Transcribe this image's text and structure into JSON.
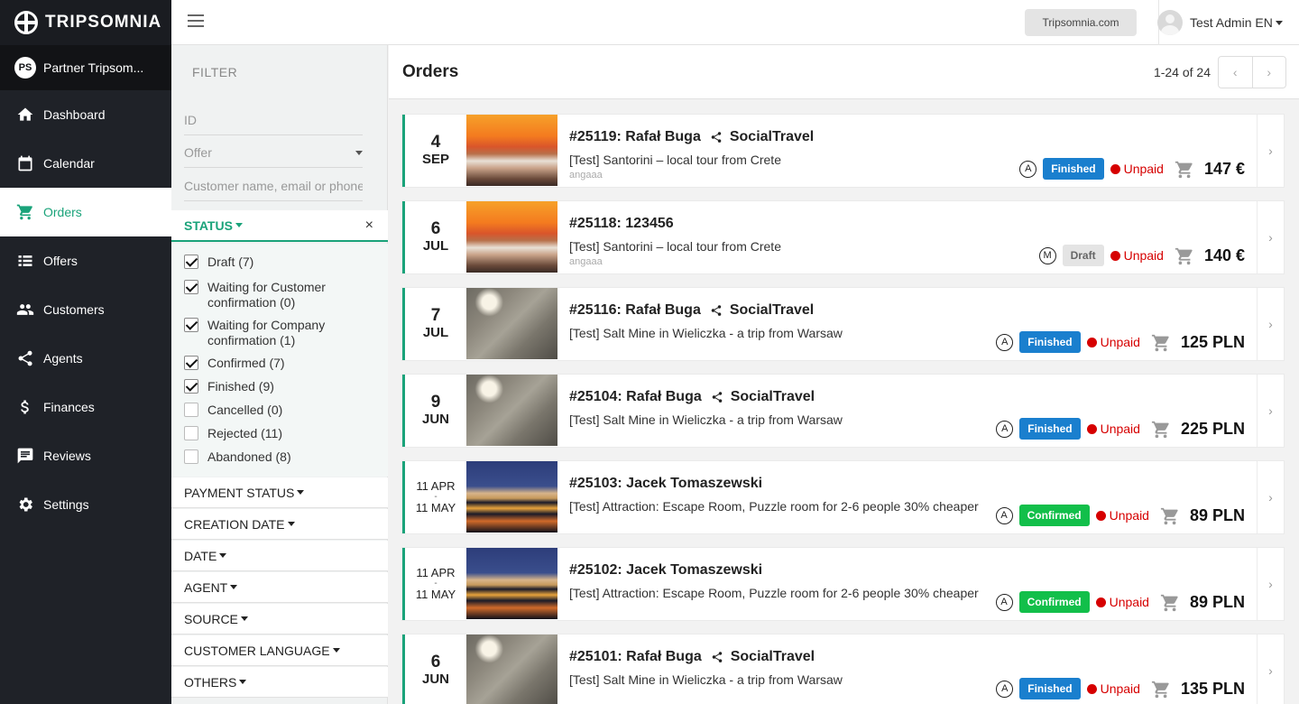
{
  "brand": {
    "name": "TRIPSOMNIA",
    "partner_initials": "PS",
    "partner_name": "Partner Tripsom..."
  },
  "sidebar": {
    "items": [
      {
        "label": "Dashboard",
        "icon": "home-icon"
      },
      {
        "label": "Calendar",
        "icon": "calendar-icon"
      },
      {
        "label": "Orders",
        "icon": "cart-icon",
        "active": true
      },
      {
        "label": "Offers",
        "icon": "list-icon"
      },
      {
        "label": "Customers",
        "icon": "people-icon"
      },
      {
        "label": "Agents",
        "icon": "share-icon"
      },
      {
        "label": "Finances",
        "icon": "dollar-icon"
      },
      {
        "label": "Reviews",
        "icon": "chat-icon"
      },
      {
        "label": "Settings",
        "icon": "gear-icon"
      }
    ]
  },
  "topbar": {
    "site_button": "Tripsomnia.com",
    "user_name": "Test Admin EN"
  },
  "filter": {
    "heading": "FILTER",
    "id_placeholder": "ID",
    "offer_placeholder": "Offer",
    "customer_placeholder": "Customer name, email or phone",
    "status_label": "STATUS",
    "status_clear": "×",
    "statuses": [
      {
        "label": "Draft (7)",
        "checked": true
      },
      {
        "label": "Waiting for Customer confirmation (0)",
        "checked": true
      },
      {
        "label": "Waiting for Company confirmation (1)",
        "checked": true
      },
      {
        "label": "Confirmed (7)",
        "checked": true
      },
      {
        "label": "Finished (9)",
        "checked": true
      },
      {
        "label": "Cancelled (0)",
        "checked": false
      },
      {
        "label": "Rejected (11)",
        "checked": false
      },
      {
        "label": "Abandoned (8)",
        "checked": false
      }
    ],
    "sections": [
      "PAYMENT STATUS",
      "CREATION DATE",
      "DATE",
      "AGENT",
      "SOURCE",
      "CUSTOMER LANGUAGE",
      "OTHERS"
    ]
  },
  "main": {
    "title": "Orders",
    "pagination": "1-24 of 24",
    "prev": "‹",
    "next": "›",
    "orders": [
      {
        "day": "4",
        "month": "SEP",
        "title": "#25119: Rafał Buga",
        "agent": "SocialTravel",
        "offer": "[Test] Santorini – local tour from Crete",
        "sub": "angaaa",
        "mark": "A",
        "status": "Finished",
        "status_type": "finished",
        "payment": "Unpaid",
        "price": "147 €",
        "image": "santorini"
      },
      {
        "day": "6",
        "month": "JUL",
        "title": "#25118: 123456",
        "agent": "",
        "offer": "[Test] Santorini – local tour from Crete",
        "sub": "angaaa",
        "mark": "M",
        "status": "Draft",
        "status_type": "draft",
        "payment": "Unpaid",
        "price": "140 €",
        "image": "santorini"
      },
      {
        "day": "7",
        "month": "JUL",
        "title": "#25116: Rafał Buga",
        "agent": "SocialTravel",
        "offer": "[Test] Salt Mine in Wieliczka - a trip from Warsaw",
        "sub": "",
        "mark": "A",
        "status": "Finished",
        "status_type": "finished",
        "payment": "Unpaid",
        "price": "125 PLN",
        "image": "mine"
      },
      {
        "day": "9",
        "month": "JUN",
        "title": "#25104: Rafał Buga",
        "agent": "SocialTravel",
        "offer": "[Test] Salt Mine in Wieliczka - a trip from Warsaw",
        "sub": "",
        "mark": "A",
        "status": "Finished",
        "status_type": "finished",
        "payment": "Unpaid",
        "price": "225 PLN",
        "image": "mine"
      },
      {
        "range_from": "11 APR",
        "range_sep": "-",
        "range_to": "11 MAY",
        "title": "#25103: Jacek Tomaszewski",
        "agent": "",
        "offer": "[Test] Attraction: Escape Room, Puzzle room for 2-6 people 30% cheaper",
        "sub": "",
        "mark": "A",
        "status": "Confirmed",
        "status_type": "confirmed",
        "payment": "Unpaid",
        "price": "89 PLN",
        "image": "city"
      },
      {
        "range_from": "11 APR",
        "range_sep": "-",
        "range_to": "11 MAY",
        "title": "#25102: Jacek Tomaszewski",
        "agent": "",
        "offer": "[Test] Attraction: Escape Room, Puzzle room for 2-6 people 30% cheaper",
        "sub": "",
        "mark": "A",
        "status": "Confirmed",
        "status_type": "confirmed",
        "payment": "Unpaid",
        "price": "89 PLN",
        "image": "city"
      },
      {
        "day": "6",
        "month": "JUN",
        "title": "#25101: Rafał Buga",
        "agent": "SocialTravel",
        "offer": "[Test] Salt Mine in Wieliczka - a trip from Warsaw",
        "sub": "",
        "mark": "A",
        "status": "Finished",
        "status_type": "finished",
        "payment": "Unpaid",
        "price": "135 PLN",
        "image": "mine"
      }
    ]
  },
  "colors": {
    "accent": "#1aa37a",
    "sidebar": "#1f2228",
    "finished": "#1a7fce",
    "confirmed": "#12bf4a",
    "unpaid": "#d60000"
  }
}
